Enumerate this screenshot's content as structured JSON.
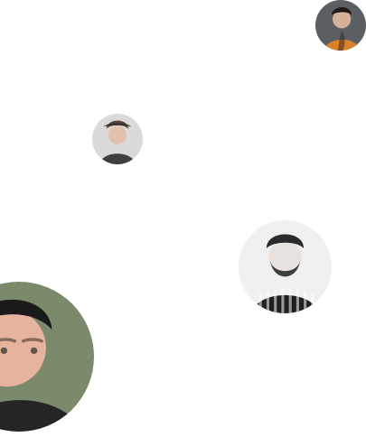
{
  "avatars": [
    {
      "id": "a1",
      "name": "avatar-woman-orange-top",
      "icon": "person-photo-icon",
      "colors": {
        "bg": "#5b5f63",
        "skin": "#d7b29a",
        "hair": "#1f1a18",
        "shirt": "#d9822b"
      }
    },
    {
      "id": "a2",
      "name": "avatar-young-man-hat",
      "icon": "person-photo-icon",
      "colors": {
        "bg": "#dadada",
        "skin": "#e2c2ad",
        "hair": "#5a4638",
        "shirt": "#3f3f3f"
      }
    },
    {
      "id": "a3",
      "name": "avatar-bearded-man-bw",
      "icon": "person-photo-icon",
      "colors": {
        "bg": "#f0f0f0",
        "skin": "#e7e2de",
        "hair": "#2b2b2b",
        "shirt": "#1f1f1f"
      }
    },
    {
      "id": "a4",
      "name": "avatar-young-man-closeup",
      "icon": "person-photo-icon",
      "colors": {
        "bg": "#7a8a6a",
        "skin": "#e6b39d",
        "hair": "#1a1a1a",
        "shirt": "#252525"
      }
    }
  ]
}
